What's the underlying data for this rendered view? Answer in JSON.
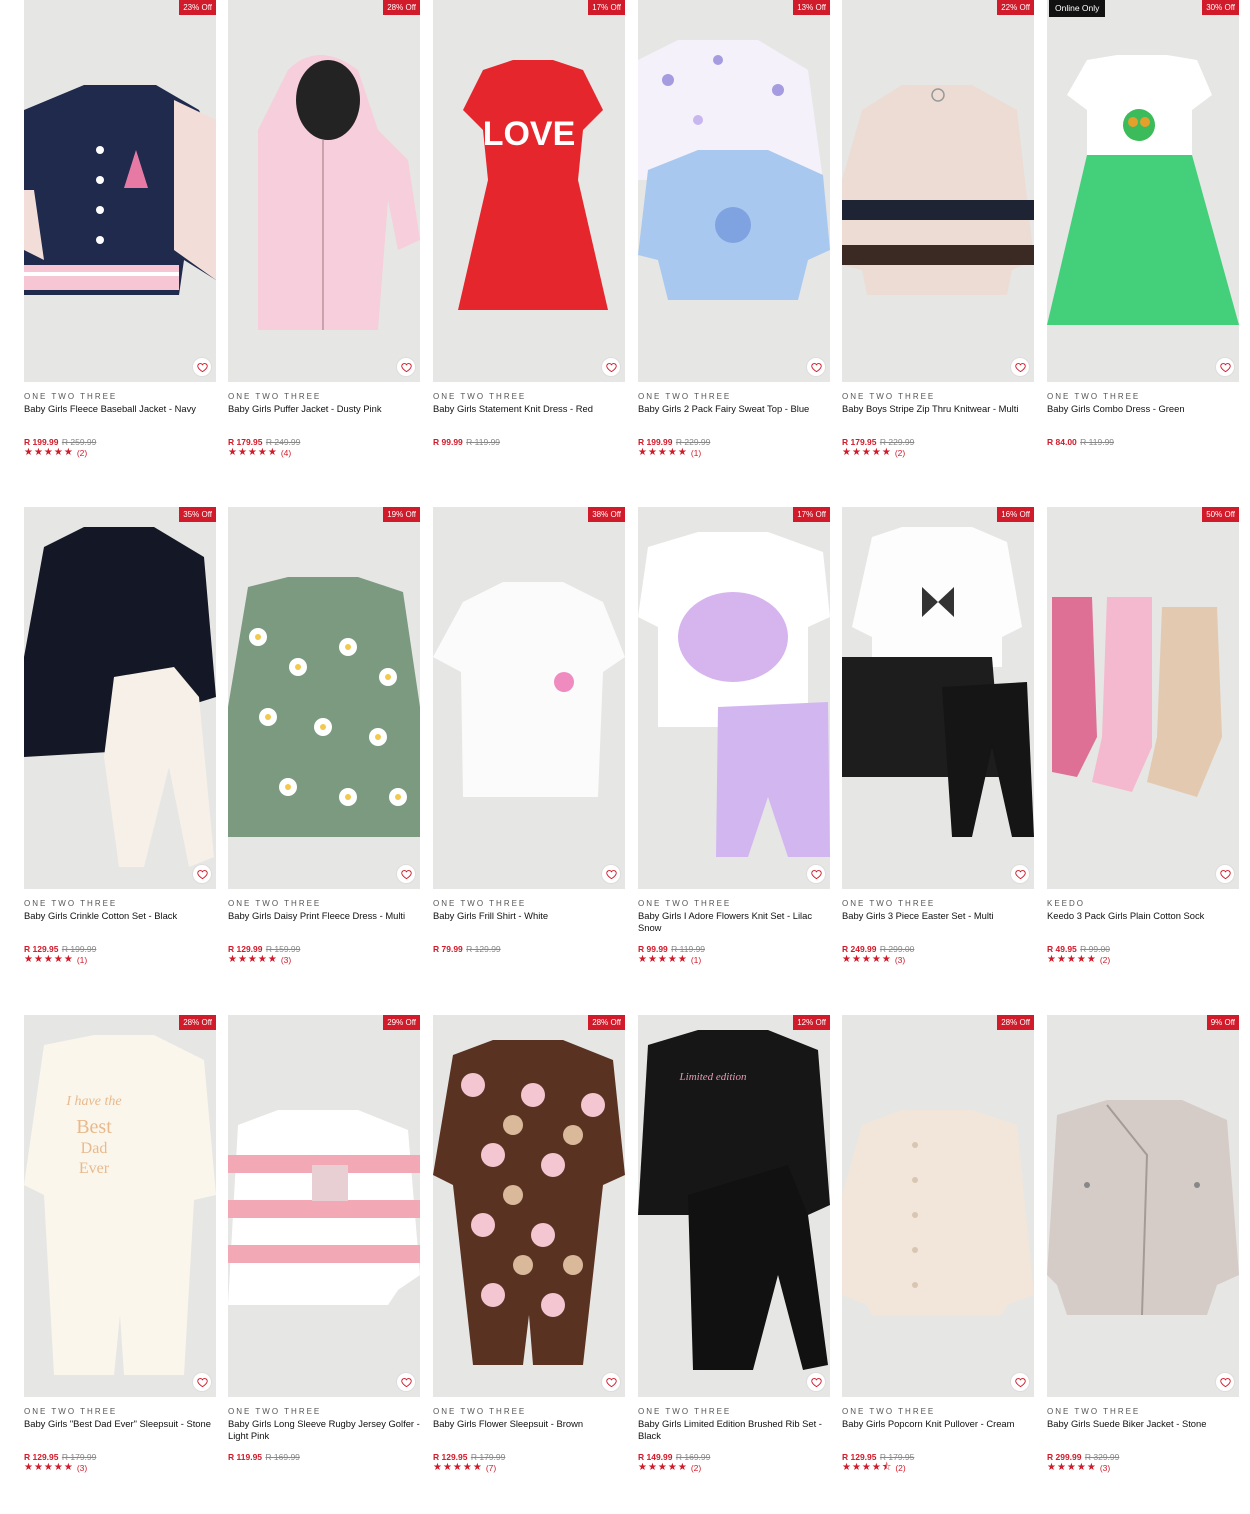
{
  "colors": {
    "accent": "#d11a2a",
    "tile_bg": "#e6e6e4",
    "online_badge": "#111111"
  },
  "products": [
    {
      "discount": "23% Off",
      "online_only": "",
      "brand": "ONE TWO THREE",
      "title": "Baby Girls Fleece Baseball Jacket - Navy",
      "price": "R 199.99",
      "was": "R 259.99",
      "stars": "★★★★★",
      "count": "(2)"
    },
    {
      "discount": "28% Off",
      "online_only": "",
      "brand": "ONE TWO THREE",
      "title": "Baby Girls Puffer Jacket - Dusty Pink",
      "price": "R 179.95",
      "was": "R 249.99",
      "stars": "★★★★★",
      "count": "(4)"
    },
    {
      "discount": "17% Off",
      "online_only": "",
      "brand": "ONE TWO THREE",
      "title": "Baby Girls Statement Knit Dress - Red",
      "price": "R 99.99",
      "was": "R 119.99",
      "stars": "",
      "count": ""
    },
    {
      "discount": "13% Off",
      "online_only": "",
      "brand": "ONE TWO THREE",
      "title": "Baby Girls 2 Pack Fairy Sweat Top - Blue",
      "price": "R 199.99",
      "was": "R 229.99",
      "stars": "★★★★★",
      "count": "(1)"
    },
    {
      "discount": "22% Off",
      "online_only": "",
      "brand": "ONE TWO THREE",
      "title": "Baby Boys Stripe Zip Thru Knitwear - Multi",
      "price": "R 179.95",
      "was": "R 229.99",
      "stars": "★★★★★",
      "count": "(2)"
    },
    {
      "discount": "30% Off",
      "online_only": "Online Only",
      "brand": "ONE TWO THREE",
      "title": "Baby Girls Combo Dress - Green",
      "price": "R 84.00",
      "was": "R 119.99",
      "stars": "",
      "count": ""
    },
    {
      "discount": "35% Off",
      "online_only": "",
      "brand": "ONE TWO THREE",
      "title": "Baby Girls Crinkle Cotton Set - Black",
      "price": "R 129.95",
      "was": "R 199.99",
      "stars": "★★★★★",
      "count": "(1)"
    },
    {
      "discount": "19% Off",
      "online_only": "",
      "brand": "ONE TWO THREE",
      "title": "Baby Girls Daisy Print Fleece Dress - Multi",
      "price": "R 129.99",
      "was": "R 159.99",
      "stars": "★★★★★",
      "count": "(3)"
    },
    {
      "discount": "38% Off",
      "online_only": "",
      "brand": "ONE TWO THREE",
      "title": "Baby Girls Frill Shirt - White",
      "price": "R 79.99",
      "was": "R 129.99",
      "stars": "",
      "count": ""
    },
    {
      "discount": "17% Off",
      "online_only": "",
      "brand": "ONE TWO THREE",
      "title": "Baby Girls I Adore Flowers Knit Set - Lilac Snow",
      "price": "R 99.99",
      "was": "R 119.99",
      "stars": "★★★★★",
      "count": "(1)"
    },
    {
      "discount": "16% Off",
      "online_only": "",
      "brand": "ONE TWO THREE",
      "title": "Baby Girls 3 Piece Easter Set - Multi",
      "price": "R 249.99",
      "was": "R 299.00",
      "stars": "★★★★★",
      "count": "(3)"
    },
    {
      "discount": "50% Off",
      "online_only": "",
      "brand": "KEEDO",
      "title": "Keedo 3 Pack Girls Plain Cotton Sock",
      "price": "R 49.95",
      "was": "R 99.00",
      "stars": "★★★★★",
      "count": "(2)"
    },
    {
      "discount": "28% Off",
      "online_only": "",
      "brand": "ONE TWO THREE",
      "title": "Baby Girls \"Best Dad Ever\" Sleepsuit - Stone",
      "price": "R 129.95",
      "was": "R 179.99",
      "stars": "★★★★★",
      "count": "(3)"
    },
    {
      "discount": "29% Off",
      "online_only": "",
      "brand": "ONE TWO THREE",
      "title": "Baby Girls Long Sleeve Rugby Jersey Golfer - Light Pink",
      "price": "R 119.95",
      "was": "R 169.99",
      "stars": "",
      "count": ""
    },
    {
      "discount": "28% Off",
      "online_only": "",
      "brand": "ONE TWO THREE",
      "title": "Baby Girls Flower Sleepsuit - Brown",
      "price": "R 129.95",
      "was": "R 179.99",
      "stars": "★★★★★",
      "count": "(7)"
    },
    {
      "discount": "12% Off",
      "online_only": "",
      "brand": "ONE TWO THREE",
      "title": "Baby Girls Limited Edition Brushed Rib Set - Black",
      "price": "R 149.99",
      "was": "R 169.99",
      "stars": "★★★★★",
      "count": "(2)"
    },
    {
      "discount": "28% Off",
      "online_only": "",
      "brand": "ONE TWO THREE",
      "title": "Baby Girls Popcorn Knit Pullover - Cream",
      "price": "R 129.95",
      "was": "R 179.95",
      "stars": "★★★★⯪",
      "count": "(2)"
    },
    {
      "discount": "9% Off",
      "online_only": "",
      "brand": "ONE TWO THREE",
      "title": "Baby Girls Suede Biker Jacket - Stone",
      "price": "R 299.99",
      "was": "R 329.99",
      "stars": "★★★★★",
      "count": "(3)"
    }
  ]
}
